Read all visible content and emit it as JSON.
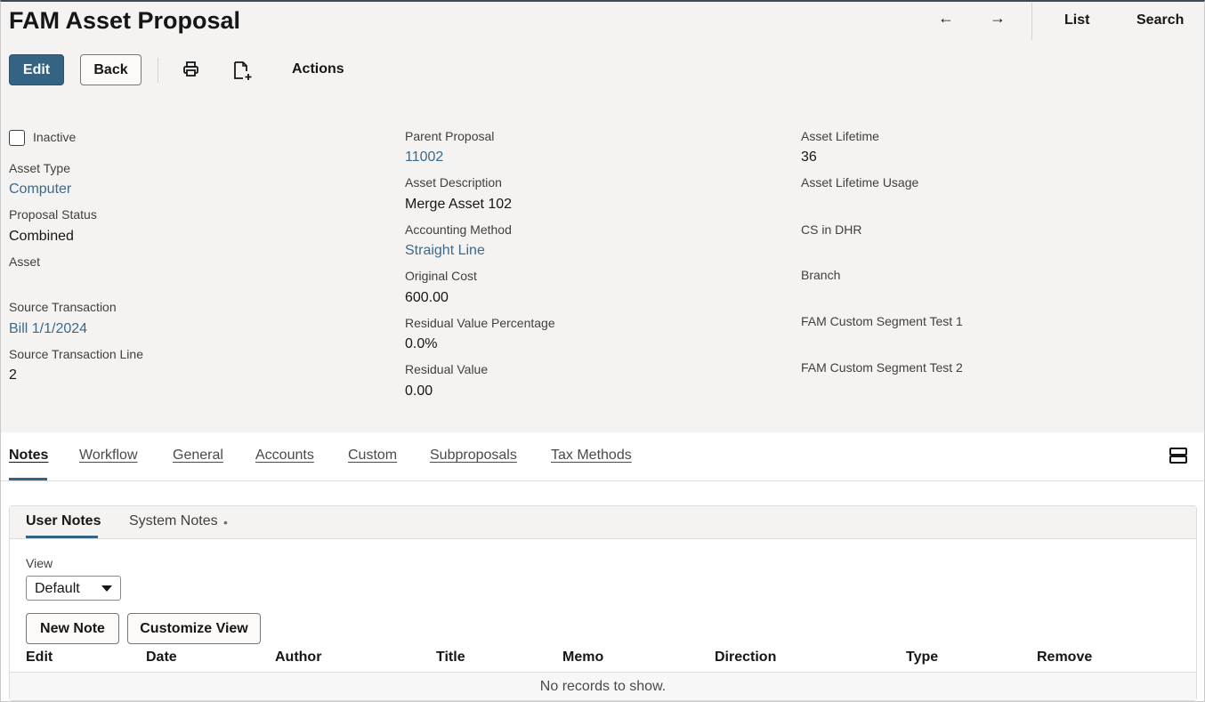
{
  "page": {
    "title": "FAM Asset Proposal"
  },
  "nav": {
    "prev_icon": "←",
    "next_icon": "→",
    "list_label": "List",
    "search_label": "Search"
  },
  "toolbar": {
    "edit_label": "Edit",
    "back_label": "Back",
    "print_icon": "printer-icon",
    "new_doc_icon": "new-document-icon",
    "actions_label": "Actions"
  },
  "fields": {
    "inactive_label": "Inactive",
    "inactive_checked": false,
    "asset_type_label": "Asset Type",
    "asset_type_value": "Computer",
    "proposal_status_label": "Proposal Status",
    "proposal_status_value": "Combined",
    "asset_label": "Asset",
    "source_transaction_label": "Source Transaction",
    "source_transaction_value": "Bill 1/1/2024",
    "source_transaction_line_label": "Source Transaction Line",
    "source_transaction_line_value": "2",
    "parent_proposal_label": "Parent Proposal",
    "parent_proposal_value": "11002",
    "asset_description_label": "Asset Description",
    "asset_description_value": "Merge Asset 102",
    "accounting_method_label": "Accounting Method",
    "accounting_method_value": "Straight Line",
    "original_cost_label": "Original Cost",
    "original_cost_value": "600.00",
    "residual_value_percentage_label": "Residual Value Percentage",
    "residual_value_percentage_value": "0.0%",
    "residual_value_label": "Residual Value",
    "residual_value_value": "0.00",
    "asset_lifetime_label": "Asset Lifetime",
    "asset_lifetime_value": "36",
    "asset_lifetime_usage_label": "Asset Lifetime Usage",
    "cs_in_dhr_label": "CS in DHR",
    "branch_label": "Branch",
    "custom_segment_1_label": "FAM Custom Segment Test 1",
    "custom_segment_2_label": "FAM Custom Segment Test 2"
  },
  "tabs": [
    {
      "label": "Notes",
      "active": true
    },
    {
      "label": "Workflow",
      "active": false
    },
    {
      "label": "General",
      "active": false
    },
    {
      "label": "Accounts",
      "active": false
    },
    {
      "label": "Custom",
      "active": false
    },
    {
      "label": "Subproposals",
      "active": false
    },
    {
      "label": "Tax Methods",
      "active": false
    }
  ],
  "notes": {
    "subtabs": [
      {
        "label": "User Notes",
        "active": true
      },
      {
        "label": "System Notes",
        "active": false,
        "marker": "•"
      }
    ],
    "view_label": "View",
    "view_selected": "Default",
    "new_note_label": "New Note",
    "customize_view_label": "Customize View",
    "columns": [
      "Edit",
      "Date",
      "Author",
      "Title",
      "Memo",
      "Direction",
      "Type",
      "Remove"
    ],
    "empty_message": "No records to show."
  },
  "colors": {
    "primary": "#346383",
    "link": "#3b6a8c",
    "header_bg": "#f4f3f1"
  }
}
